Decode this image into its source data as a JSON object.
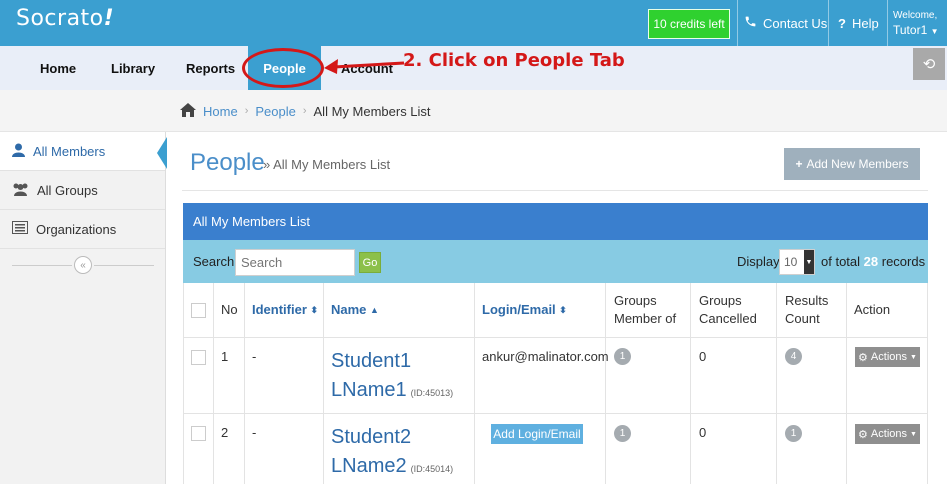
{
  "header": {
    "logo": "Socrato",
    "logo_mark": "!",
    "credits": "10 credits left",
    "contact_label": "Contact Us",
    "help_label": "Help",
    "welcome": "Welcome,",
    "user": "Tutor1"
  },
  "nav": {
    "items": [
      {
        "label": "Home"
      },
      {
        "label": "Library"
      },
      {
        "label": "Reports"
      },
      {
        "label": "People"
      },
      {
        "label": "Account"
      }
    ],
    "active": "People",
    "annotation": "2. Click on People Tab"
  },
  "breadcrumb": {
    "items": [
      "Home",
      "People",
      "All My Members List"
    ]
  },
  "sidebar": {
    "items": [
      {
        "label": "All Members",
        "icon": "user-icon"
      },
      {
        "label": "All Groups",
        "icon": "users-icon"
      },
      {
        "label": "Organizations",
        "icon": "list-icon"
      }
    ],
    "collapse_icon": "«"
  },
  "main": {
    "title": "People",
    "subtitle": "» All My Members List",
    "add_button": "Add New Members"
  },
  "panel": {
    "title": "All My Members List",
    "search_label": "Search:",
    "search_placeholder": "Search",
    "go_label": "Go",
    "display_label": "Display",
    "display_value": "10",
    "total_prefix": "of total",
    "total_count": "28",
    "total_suffix": "records"
  },
  "table": {
    "headers": {
      "no": "No",
      "identifier": "Identifier",
      "name": "Name",
      "login": "Login/Email",
      "groups_member_l1": "Groups",
      "groups_member_l2": "Member of",
      "groups_cancelled_l1": "Groups",
      "groups_cancelled_l2": "Cancelled",
      "results_l1": "Results",
      "results_l2": "Count",
      "action": "Action"
    },
    "rows": [
      {
        "no": "1",
        "identifier": "-",
        "first": "Student1",
        "last": "LName1",
        "id": "(ID:45013)",
        "login": "ankur@malinator.com",
        "groups_member": "1",
        "groups_cancelled": "0",
        "results": "4",
        "action": "Actions"
      },
      {
        "no": "2",
        "identifier": "-",
        "first": "Student2",
        "last": "LName2",
        "id": "(ID:45014)",
        "login_button": "Add Login/Email",
        "groups_member": "1",
        "groups_cancelled": "0",
        "results": "1",
        "action": "Actions"
      }
    ]
  }
}
